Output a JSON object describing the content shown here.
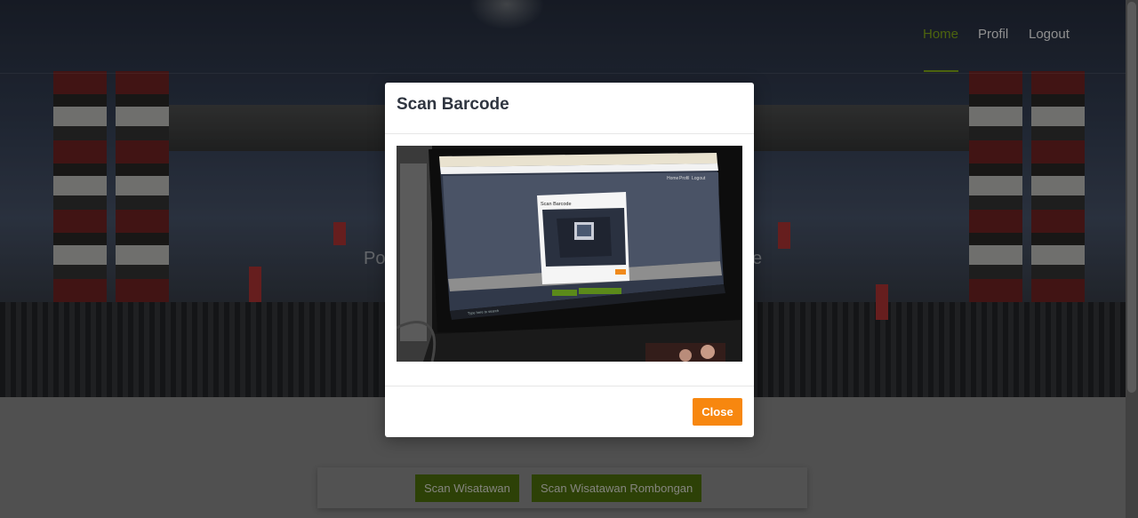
{
  "nav": {
    "home": "Home",
    "profil": "Profil",
    "logout": "Logout"
  },
  "hero": {
    "text_left": "Po",
    "text_right": "e"
  },
  "actions": {
    "scan_wisatawan": "Scan Wisatawan",
    "scan_rombongan": "Scan Wisatawan Rombongan"
  },
  "modal": {
    "title": "Scan Barcode",
    "close_label": "Close",
    "camera": {
      "inner_dialog_title": "Scan Barcode",
      "inner_close_label": "Close",
      "inner_nav": [
        "Home",
        "Profil",
        "Logout"
      ],
      "taskbar_search": "Type here to search"
    }
  },
  "colors": {
    "accent_green": "#6a8a14",
    "button_green": "#5f870c",
    "close_orange": "#f7870f"
  },
  "icons": [
    "camera-feed-icon"
  ]
}
